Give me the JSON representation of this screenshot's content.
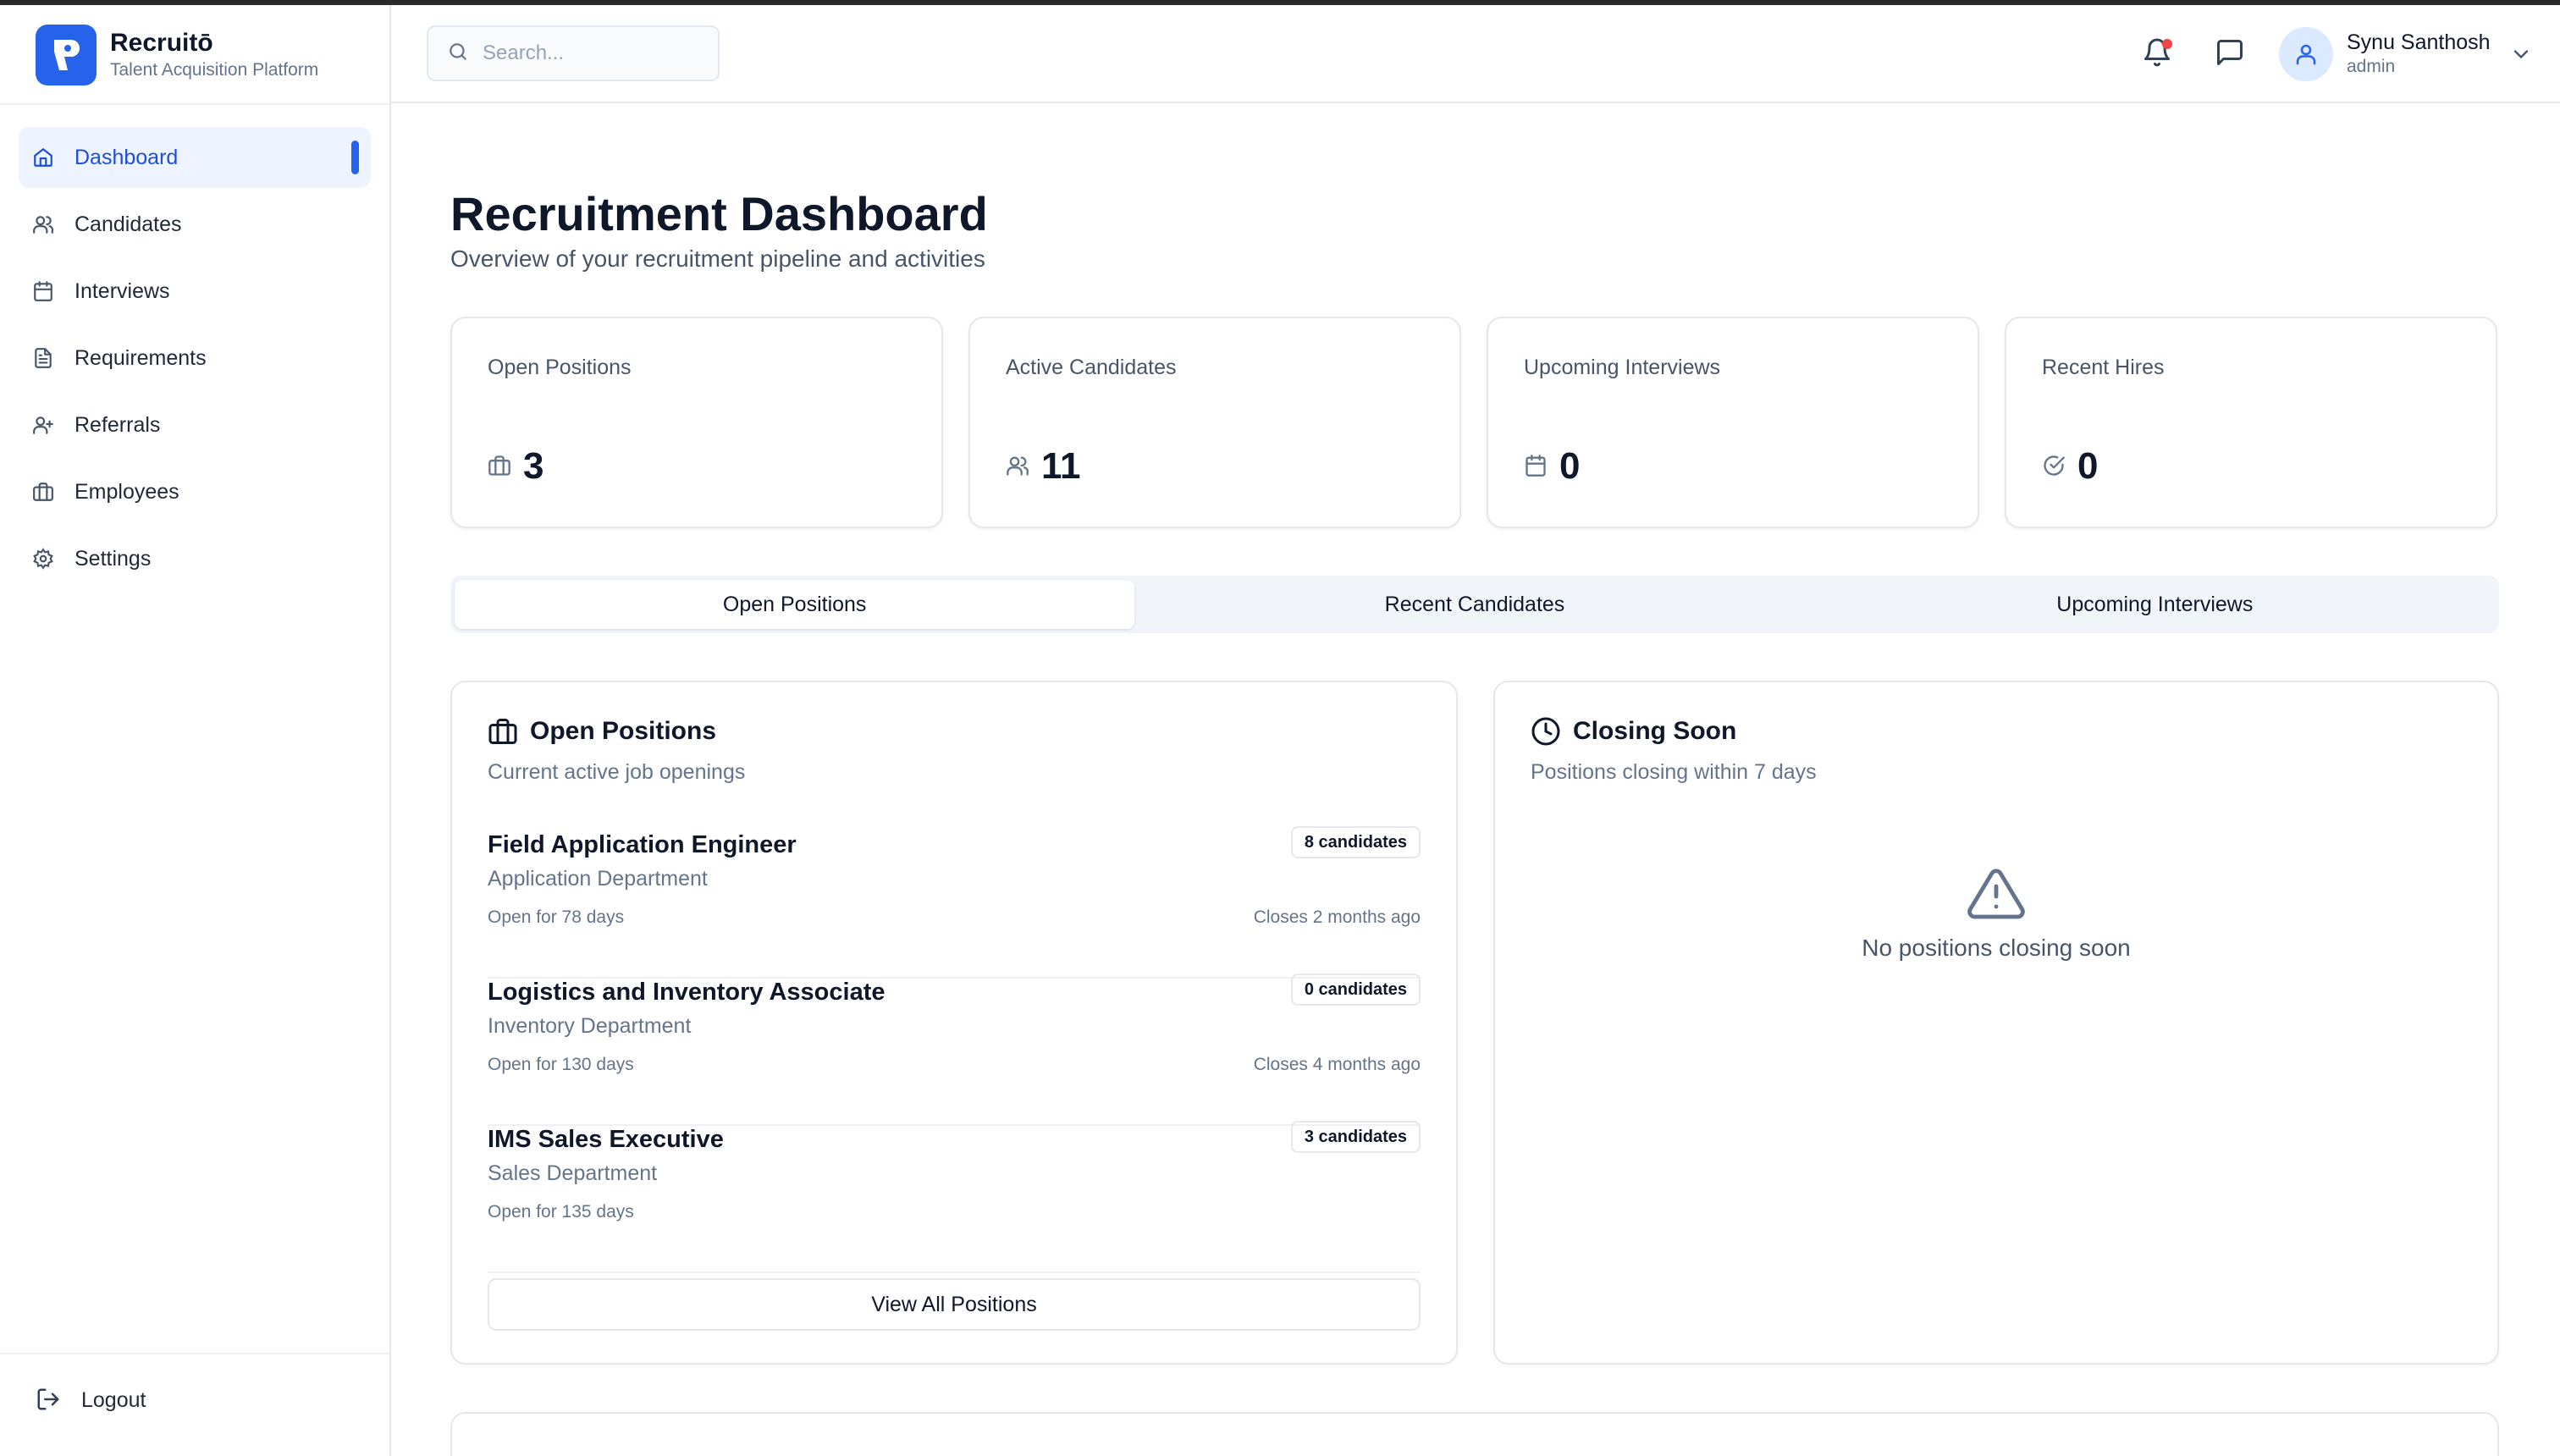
{
  "brand": {
    "name": "Recruitō",
    "subtitle": "Talent Acquisition Platform"
  },
  "sidebar": {
    "items": [
      {
        "label": "Dashboard",
        "icon": "home-icon",
        "active": true
      },
      {
        "label": "Candidates",
        "icon": "users-icon"
      },
      {
        "label": "Interviews",
        "icon": "calendar-icon"
      },
      {
        "label": "Requirements",
        "icon": "file-text-icon"
      },
      {
        "label": "Referrals",
        "icon": "user-plus-icon"
      },
      {
        "label": "Employees",
        "icon": "briefcase-icon"
      },
      {
        "label": "Settings",
        "icon": "gear-icon"
      }
    ],
    "logout_label": "Logout"
  },
  "header": {
    "search_placeholder": "Search...",
    "user": {
      "name": "Synu Santhosh",
      "role": "admin"
    }
  },
  "page": {
    "title": "Recruitment Dashboard",
    "subtitle": "Overview of your recruitment pipeline and activities"
  },
  "stats": [
    {
      "label": "Open Positions",
      "value": "3",
      "icon": "briefcase-icon"
    },
    {
      "label": "Active Candidates",
      "value": "11",
      "icon": "users-icon"
    },
    {
      "label": "Upcoming Interviews",
      "value": "0",
      "icon": "calendar-icon"
    },
    {
      "label": "Recent Hires",
      "value": "0",
      "icon": "check-circle-icon"
    }
  ],
  "tabs": [
    {
      "label": "Open Positions",
      "active": true
    },
    {
      "label": "Recent Candidates"
    },
    {
      "label": "Upcoming Interviews"
    }
  ],
  "open_positions": {
    "title": "Open Positions",
    "subtitle": "Current active job openings",
    "items": [
      {
        "title": "Field Application Engineer",
        "department": "Application Department",
        "candidates": "8 candidates",
        "open_for": "Open for 78 days",
        "closes": "Closes 2 months ago"
      },
      {
        "title": "Logistics and Inventory Associate",
        "department": "Inventory Department",
        "candidates": "0 candidates",
        "open_for": "Open for 130 days",
        "closes": "Closes 4 months ago"
      },
      {
        "title": "IMS Sales Executive",
        "department": "Sales Department",
        "candidates": "3 candidates",
        "open_for": "Open for 135 days",
        "closes": ""
      }
    ],
    "view_all_label": "View All Positions"
  },
  "closing_soon": {
    "title": "Closing Soon",
    "subtitle": "Positions closing within 7 days",
    "empty_text": "No positions closing soon"
  },
  "colors": {
    "accent": "#2563eb",
    "notification": "#ef4444",
    "active_nav_bg": "#eef4ff"
  }
}
